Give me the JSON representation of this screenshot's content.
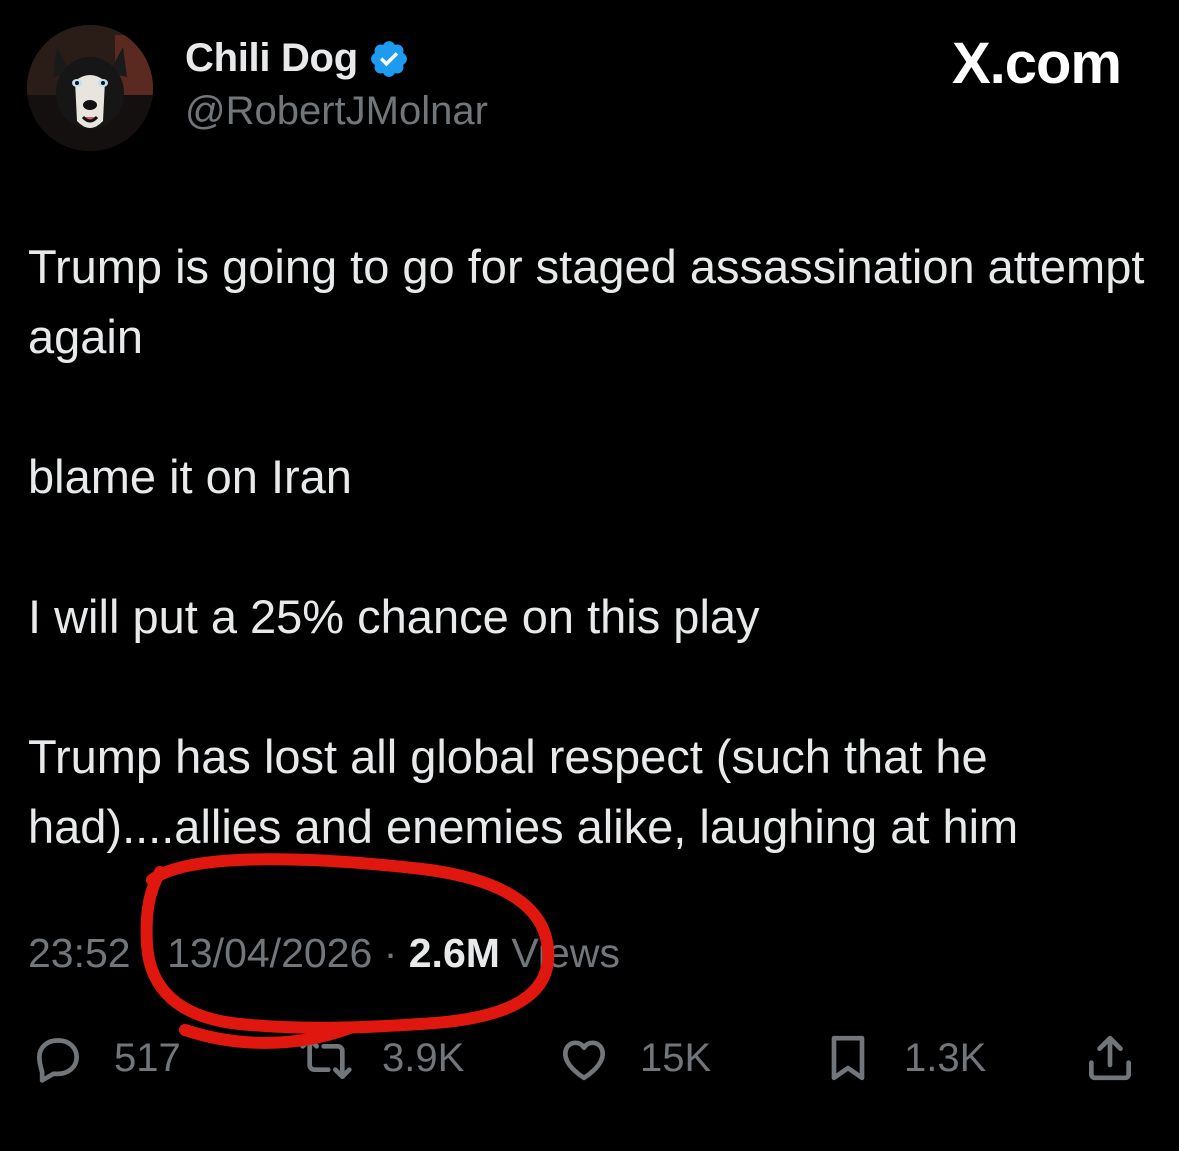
{
  "tweet": {
    "author": {
      "display_name": "Chili Dog",
      "handle": "@RobertJMolnar",
      "verified": true,
      "avatar": "husky-dog-avatar"
    },
    "watermark": "X.com",
    "paragraphs": [
      "Trump is going to go for staged assassination attempt again",
      "blame it on Iran",
      "I will put a 25% chance on this play",
      "Trump has lost all global respect (such that he had)....allies and enemies alike, laughing at him"
    ],
    "time": "23:52",
    "date": "13/04/2026",
    "separator": "·",
    "views_count": "2.6M",
    "views_label": "Views",
    "actions": {
      "replies": "517",
      "reposts": "3.9K",
      "likes": "15K",
      "bookmarks": "1.3K"
    }
  },
  "colors": {
    "background": "#000000",
    "text_primary": "#e7e9ea",
    "text_secondary": "#71767b",
    "verified_badge": "#1d9bf0",
    "annotation": "#e0170f"
  },
  "icons": [
    "verified-badge-icon",
    "reply-icon",
    "repost-icon",
    "like-icon",
    "bookmark-icon",
    "share-icon"
  ]
}
